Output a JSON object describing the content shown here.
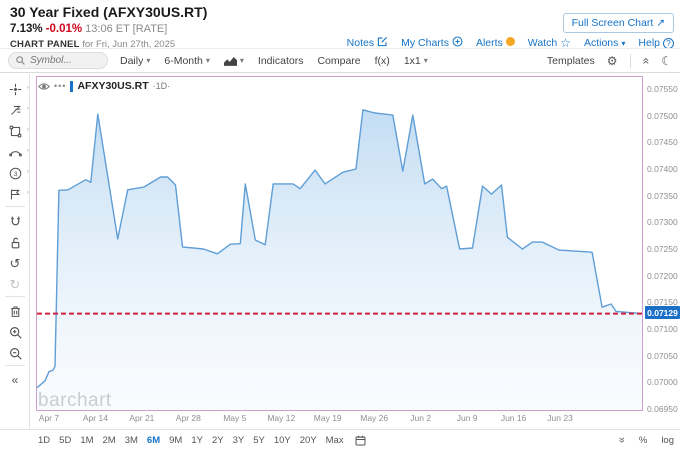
{
  "header": {
    "title": "30 Year Fixed (AFXY30US.RT)",
    "quote": {
      "price": "7.13%",
      "change": "-0.01%",
      "time": "13:06 ET [RATE]"
    },
    "panel_label": "CHART PANEL",
    "panel_date": "for Fri, Jun 27th, 2025",
    "fullscreen_label": "Full Screen Chart",
    "fullscreen_arrow": "↗",
    "links": [
      {
        "label": "Notes",
        "icon": "notes-icon"
      },
      {
        "label": "My Charts",
        "icon": "plus-circle-icon"
      },
      {
        "label": "Alerts",
        "icon": "alert-badge-icon"
      },
      {
        "label": "Watch",
        "icon": "star-icon"
      },
      {
        "label": "Actions",
        "icon": "caret-down-icon"
      },
      {
        "label": "Help",
        "icon": "help-icon"
      }
    ]
  },
  "toolbar": {
    "symbol_placeholder": "Symbol...",
    "frequency": "Daily",
    "range": "6-Month",
    "indicators": "Indicators",
    "compare": "Compare",
    "fx": "f(x)",
    "grid_layout": "1x1",
    "templates": "Templates"
  },
  "sidebar": {
    "tools": [
      "cursor",
      "annotations",
      "shapes",
      "arc",
      "fibonacci",
      "flag"
    ],
    "actions": [
      "magnet",
      "lock",
      "undo",
      "redo"
    ],
    "edit": [
      "trash",
      "zoom-in",
      "zoom-out"
    ],
    "collapse": "collapse-left"
  },
  "chart": {
    "legend_symbol": "AFXY30US.RT",
    "legend_period": "1D",
    "watermark": "barchart",
    "current_value_label": "0.07129",
    "accent_blue": "#1673c7",
    "line_color": "#5f9ed6",
    "dashed_line_color": "#cf2440",
    "badge_color": "#1b6fc7",
    "frame_color": "#cf9ecf"
  },
  "chart_data": {
    "type": "area",
    "title": "AFXY30US.RT 1D",
    "ylim": [
      0.0695,
      0.0755
    ],
    "y_ticks": [
      "0.07550",
      "0.07500",
      "0.07450",
      "0.07400",
      "0.07350",
      "0.07300",
      "0.07250",
      "0.07200",
      "0.07150",
      "0.07100",
      "0.07050",
      "0.07000",
      "0.06950"
    ],
    "y_tick_values": [
      0.0755,
      0.075,
      0.0745,
      0.074,
      0.0735,
      0.073,
      0.0725,
      0.072,
      0.0715,
      0.071,
      0.0705,
      0.07,
      0.0695
    ],
    "current_value": 0.07129,
    "x_tick_labels": [
      "Apr 7",
      "Apr 14",
      "Apr 21",
      "Apr 28",
      "May 5",
      "May 12",
      "May 19",
      "May 26",
      "Jun 2",
      "Jun 9",
      "Jun 16",
      "Jun 23"
    ],
    "x_tick_fracs": [
      0.0214,
      0.0982,
      0.175,
      0.2518,
      0.3286,
      0.4054,
      0.4822,
      0.559,
      0.6358,
      0.7126,
      0.7894,
      0.8662
    ],
    "grid": false,
    "legend_position": "top-left",
    "series": [
      {
        "name": "AFXY30US.RT",
        "points": [
          [
            0.0,
            0.0699
          ],
          [
            0.0132,
            0.07003
          ],
          [
            0.0198,
            0.0702
          ],
          [
            0.0264,
            0.07023
          ],
          [
            0.0297,
            0.0703
          ],
          [
            0.0362,
            0.0736
          ],
          [
            0.0511,
            0.07361
          ],
          [
            0.0807,
            0.0738
          ],
          [
            0.0889,
            0.07375
          ],
          [
            0.1005,
            0.07503
          ],
          [
            0.1334,
            0.07269
          ],
          [
            0.1499,
            0.07361
          ],
          [
            0.1763,
            0.07366
          ],
          [
            0.2043,
            0.07385
          ],
          [
            0.2158,
            0.07385
          ],
          [
            0.229,
            0.0737
          ],
          [
            0.2405,
            0.07254
          ],
          [
            0.2751,
            0.0725
          ],
          [
            0.2982,
            0.07241
          ],
          [
            0.3196,
            0.07259
          ],
          [
            0.3361,
            0.0726
          ],
          [
            0.3443,
            0.07372
          ],
          [
            0.3608,
            0.07267
          ],
          [
            0.3772,
            0.07258
          ],
          [
            0.3904,
            0.07372
          ],
          [
            0.4233,
            0.07372
          ],
          [
            0.4349,
            0.07363
          ],
          [
            0.4596,
            0.07398
          ],
          [
            0.4761,
            0.07372
          ],
          [
            0.5058,
            0.07394
          ],
          [
            0.5272,
            0.074
          ],
          [
            0.5387,
            0.07511
          ],
          [
            0.5585,
            0.07505
          ],
          [
            0.5881,
            0.07501
          ],
          [
            0.6046,
            0.07396
          ],
          [
            0.6211,
            0.07501
          ],
          [
            0.6408,
            0.07372
          ],
          [
            0.654,
            0.07381
          ],
          [
            0.6688,
            0.07363
          ],
          [
            0.6771,
            0.07368
          ],
          [
            0.6985,
            0.0725
          ],
          [
            0.7199,
            0.07252
          ],
          [
            0.7364,
            0.07368
          ],
          [
            0.7512,
            0.07353
          ],
          [
            0.7677,
            0.0737
          ],
          [
            0.7776,
            0.07272
          ],
          [
            0.8023,
            0.0725
          ],
          [
            0.8188,
            0.07263
          ],
          [
            0.8352,
            0.07263
          ],
          [
            0.8632,
            0.07248
          ],
          [
            0.9176,
            0.07244
          ],
          [
            0.9341,
            0.07141
          ],
          [
            0.9489,
            0.07147
          ],
          [
            0.9571,
            0.07133
          ],
          [
            1.0,
            0.07129
          ]
        ]
      }
    ]
  },
  "footer": {
    "ranges": [
      "1D",
      "5D",
      "1M",
      "2M",
      "3M",
      "6M",
      "9M",
      "1Y",
      "2Y",
      "3Y",
      "5Y",
      "10Y",
      "20Y",
      "Max"
    ],
    "selected": "6M",
    "percent_label": "%",
    "log_label": "log"
  }
}
